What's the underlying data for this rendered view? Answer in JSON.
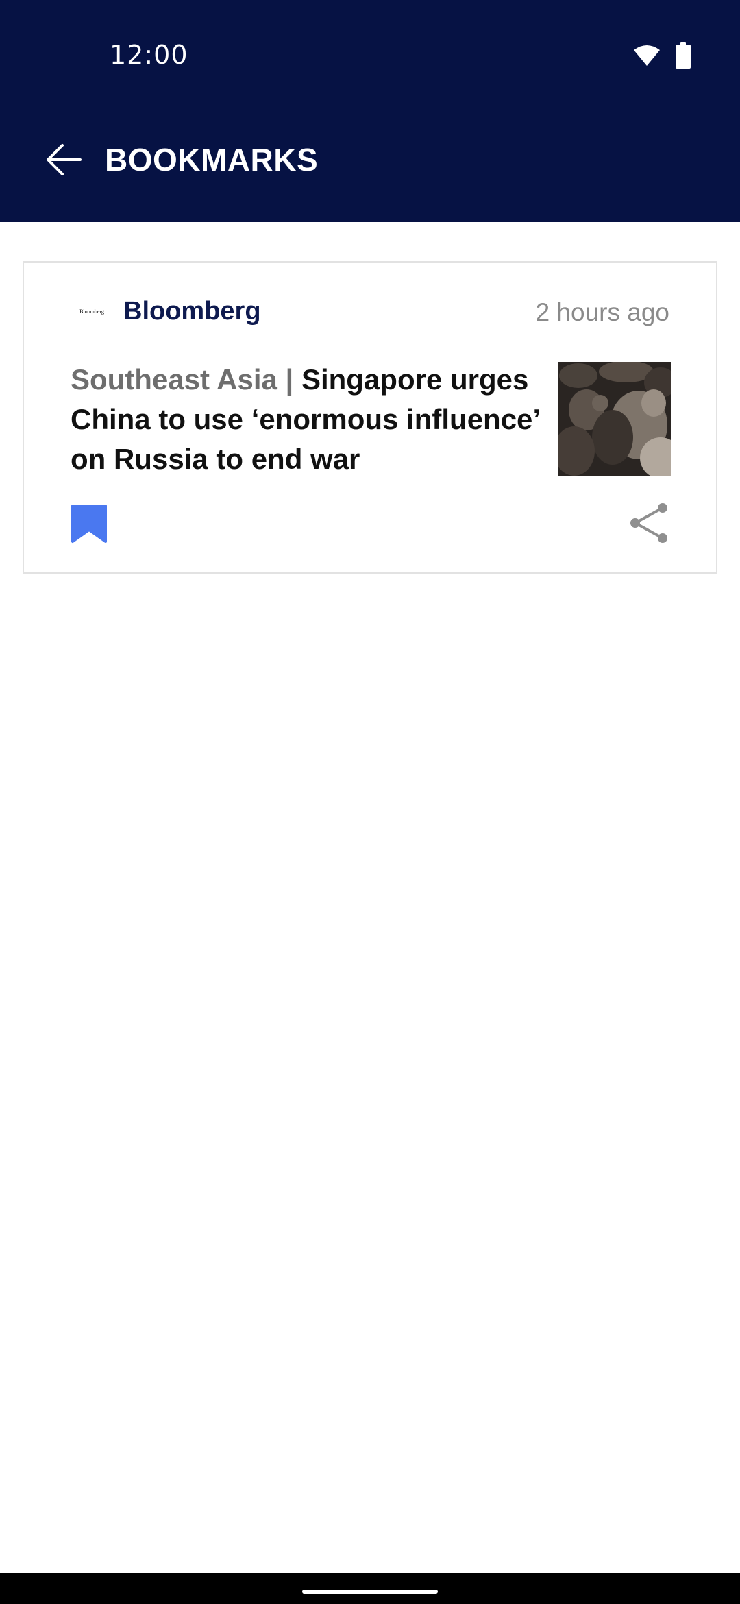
{
  "status_bar": {
    "time": "12:00",
    "icons": [
      "wifi-icon",
      "battery-icon"
    ]
  },
  "app_bar": {
    "back_icon": "arrow-left-icon",
    "title": "BOOKMARKS",
    "background": "#061244"
  },
  "bookmarks": [
    {
      "source": {
        "logo_text": "Bloomberg",
        "name": "Bloomberg"
      },
      "timestamp": "2 hours ago",
      "section": "Southeast Asia | ",
      "title": "Singapore urges China to use ‘enormous influence’ on Russia to end war",
      "bookmark_icon": "bookmark-filled-icon",
      "bookmark_color": "#4a78f0",
      "share_icon": "share-icon"
    }
  ]
}
